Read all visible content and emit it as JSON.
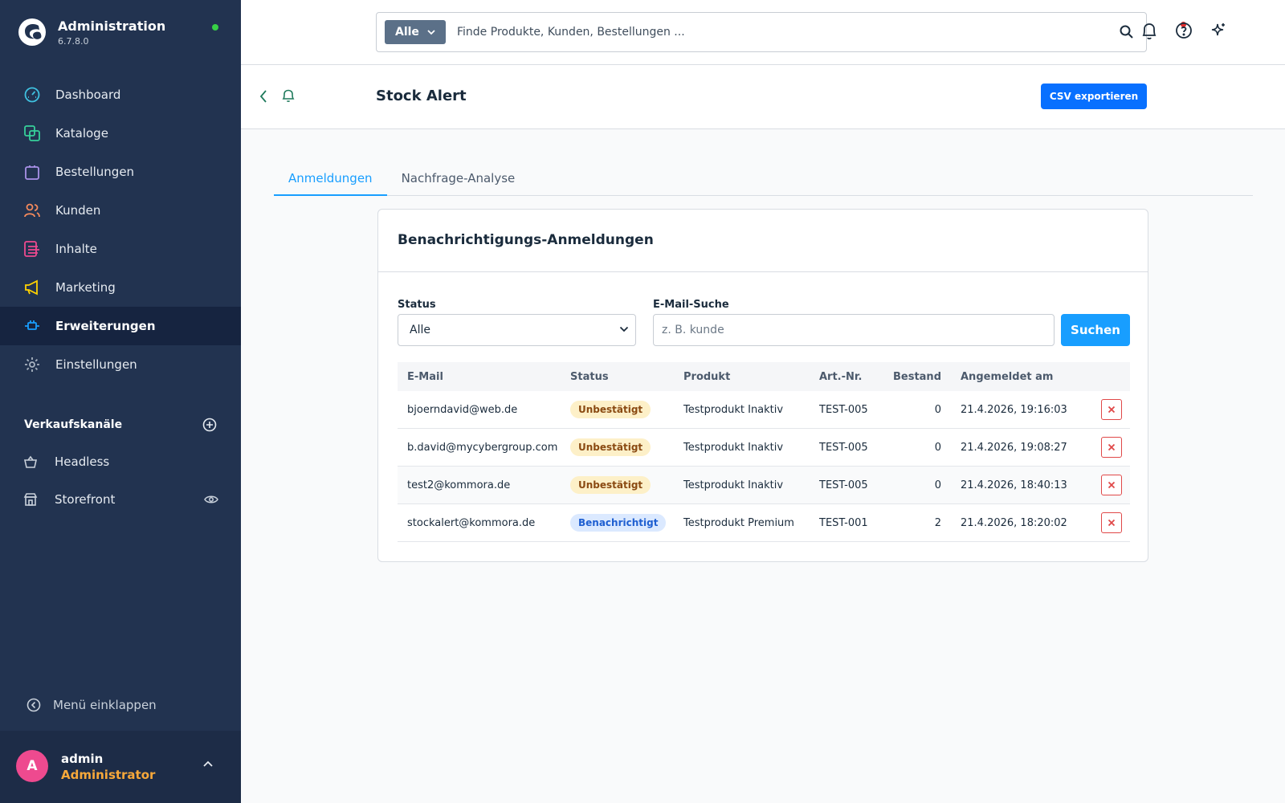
{
  "app": {
    "title": "Administration",
    "version": "6.7.8.0"
  },
  "sidebar": {
    "items": [
      {
        "label": "Dashboard",
        "icon": "gauge-icon",
        "color": "#3fc1e0"
      },
      {
        "label": "Kataloge",
        "icon": "catalog-icon",
        "color": "#37d09a"
      },
      {
        "label": "Bestellungen",
        "icon": "shopping-bag-icon",
        "color": "#a991e8"
      },
      {
        "label": "Kunden",
        "icon": "users-icon",
        "color": "#f58a5c"
      },
      {
        "label": "Inhalte",
        "icon": "content-icon",
        "color": "#ee4a8f"
      },
      {
        "label": "Marketing",
        "icon": "megaphone-icon",
        "color": "#ffd200"
      },
      {
        "label": "Erweiterungen",
        "icon": "plug-icon",
        "color": "#189eff",
        "active": true
      },
      {
        "label": "Einstellungen",
        "icon": "gear-icon",
        "color": "#a8b3c0"
      }
    ],
    "channels_title": "Verkaufskanäle",
    "channels": [
      {
        "label": "Headless",
        "icon": "basket-icon"
      },
      {
        "label": "Storefront",
        "icon": "store-icon"
      }
    ],
    "collapse_label": "Menü einklappen"
  },
  "user": {
    "initial": "A",
    "name": "admin",
    "role": "Administrator"
  },
  "search": {
    "scope": "Alle",
    "placeholder": "Finde Produkte, Kunden, Bestellungen ..."
  },
  "page": {
    "title": "Stock Alert",
    "export_label": "CSV exportieren"
  },
  "tabs": [
    {
      "label": "Anmeldungen",
      "active": true
    },
    {
      "label": "Nachfrage-Analyse",
      "active": false
    }
  ],
  "card": {
    "title": "Benachrichtigungs-Anmeldungen",
    "status_label": "Status",
    "status_value": "Alle",
    "email_label": "E-Mail-Suche",
    "email_placeholder": "z. B. kunde",
    "search_button": "Suchen"
  },
  "table": {
    "headers": [
      "E-Mail",
      "Status",
      "Produkt",
      "Art.-Nr.",
      "Bestand",
      "Angemeldet am"
    ],
    "rows": [
      {
        "email": "bjoerndavid@web.de",
        "status": "Unbestätigt",
        "status_type": "warn",
        "product": "Testprodukt Inaktiv",
        "sku": "TEST-005",
        "stock": "0",
        "date": "21.4.2026, 19:16:03"
      },
      {
        "email": "b.david@mycybergroup.com",
        "status": "Unbestätigt",
        "status_type": "warn",
        "product": "Testprodukt Inaktiv",
        "sku": "TEST-005",
        "stock": "0",
        "date": "21.4.2026, 19:08:27"
      },
      {
        "email": "test2@kommora.de",
        "status": "Unbestätigt",
        "status_type": "warn",
        "product": "Testprodukt Inaktiv",
        "sku": "TEST-005",
        "stock": "0",
        "date": "21.4.2026, 18:40:13"
      },
      {
        "email": "stockalert@kommora.de",
        "status": "Benachrichtigt",
        "status_type": "info",
        "product": "Testprodukt Premium",
        "sku": "TEST-001",
        "stock": "2",
        "date": "21.4.2026, 18:20:02"
      }
    ]
  },
  "colors": {
    "sidebar_bg": "#223350",
    "primary": "#0870ff",
    "accent": "#189eff",
    "danger": "#e04848"
  }
}
